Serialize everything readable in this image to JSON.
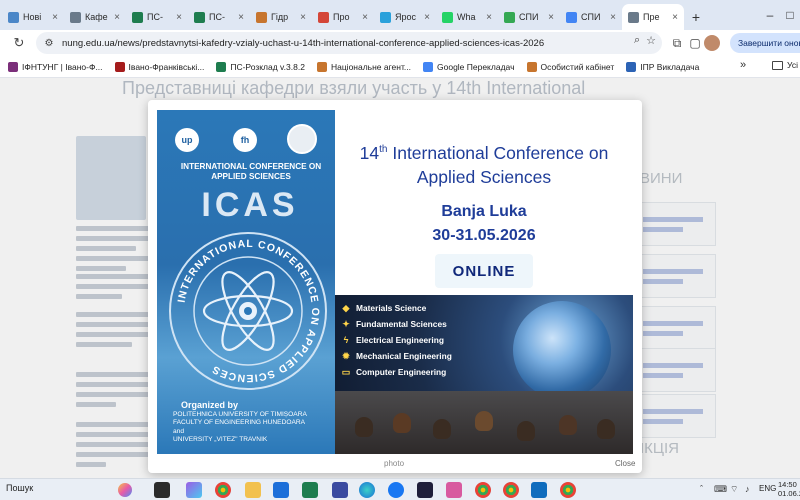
{
  "browser": {
    "tabs": [
      {
        "label": "Нові",
        "color": "#4b87c8"
      },
      {
        "label": "Кафе",
        "color": "#6a7a8a"
      },
      {
        "label": "ПС-",
        "color": "#1e7d4f"
      },
      {
        "label": "ПС-",
        "color": "#1e7d4f"
      },
      {
        "label": "Гідр",
        "color": "#c7752e"
      },
      {
        "label": "Про",
        "color": "#d44638"
      },
      {
        "label": "Ярос",
        "color": "#2aa1db"
      },
      {
        "label": "Wha",
        "color": "#25d366"
      },
      {
        "label": "СПИ",
        "color": "#34a853"
      },
      {
        "label": "СПИ",
        "color": "#4285f4"
      },
      {
        "label": "Пре",
        "color": "#6a7a8a",
        "active": true
      }
    ],
    "tab_close": "×",
    "new_tab": "+",
    "url": "nung.edu.ua/news/predstavnytsi-kafedry-vzialy-uchast-u-14th-international-conference-applied-sciences-icas-2026",
    "finish_button": "Завершити онов",
    "bookmarks": [
      {
        "label": "ІФНТУНГ | Івано-Ф...",
        "color": "#7b2f7a"
      },
      {
        "label": "Івано-Франківські...",
        "color": "#a51c1c"
      },
      {
        "label": "ПС-Розклад v.3.8.2",
        "color": "#1e7d4f"
      },
      {
        "label": "Національне агент...",
        "color": "#c7752e"
      },
      {
        "label": "Google Перекладач",
        "color": "#4285f4"
      },
      {
        "label": "Особистий кабінет",
        "color": "#c7752e"
      },
      {
        "label": "ІПР Викладача",
        "color": "#2c63b5"
      }
    ],
    "bookmarks_more": "»",
    "bookmarks_folder": "Усі"
  },
  "page": {
    "bg_title": "Представниці кафедри взяли участь у 14th International",
    "side_heading": "ВИНИ",
    "side_heading2": "ІКЦІЯ"
  },
  "modal": {
    "caption": "photo",
    "close": "Close"
  },
  "poster": {
    "conference_label": "INTERNATIONAL CONFERENCE ON APPLIED SCIENCES",
    "acronym": "ICAS",
    "ring_text": "INTERNATIONAL CONFERENCE ON APPLIED SCIENCES",
    "headline_ordinal": "14",
    "headline_suffix": "th",
    "headline_rest": " International Conference on Applied Sciences",
    "city": "Banja Luka",
    "dates": "30-31.05.2026",
    "online": "ONLINE",
    "topics": [
      "Materials Science",
      "Fundamental Sciences",
      "Electrical Engineering",
      "Mechanical Engineering",
      "Computer Engineering"
    ],
    "organized_title": "Organized by",
    "organizers": [
      "POLITEHNICA UNIVERSITY OF TIMIȘOARA",
      "FACULTY OF ENGINEERING HUNEDOARA",
      "and",
      "UNIVERSITY „VITEZ\" TRAVNIK"
    ]
  },
  "taskbar": {
    "search_label": "Пошук",
    "lang": "ENG",
    "time": "14:50",
    "date": "01.06.2"
  }
}
